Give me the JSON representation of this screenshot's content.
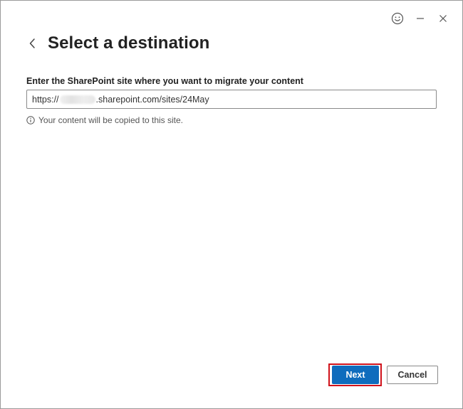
{
  "window": {
    "controls": [
      {
        "name": "feedback-smiley-icon"
      },
      {
        "name": "minimize-icon"
      },
      {
        "name": "close-icon"
      }
    ]
  },
  "header": {
    "back_icon": "chevron-left-icon",
    "title": "Select a destination"
  },
  "form": {
    "label": "Enter the SharePoint site where you want to migrate your content",
    "url_prefix": "https://",
    "url_suffix": ".sharepoint.com/sites/24May",
    "info_icon": "info-icon",
    "info_text": "Your content will be copied to this site."
  },
  "footer": {
    "next_label": "Next",
    "cancel_label": "Cancel"
  },
  "colors": {
    "primary": "#0f6cbd",
    "highlight": "#d0121b"
  }
}
